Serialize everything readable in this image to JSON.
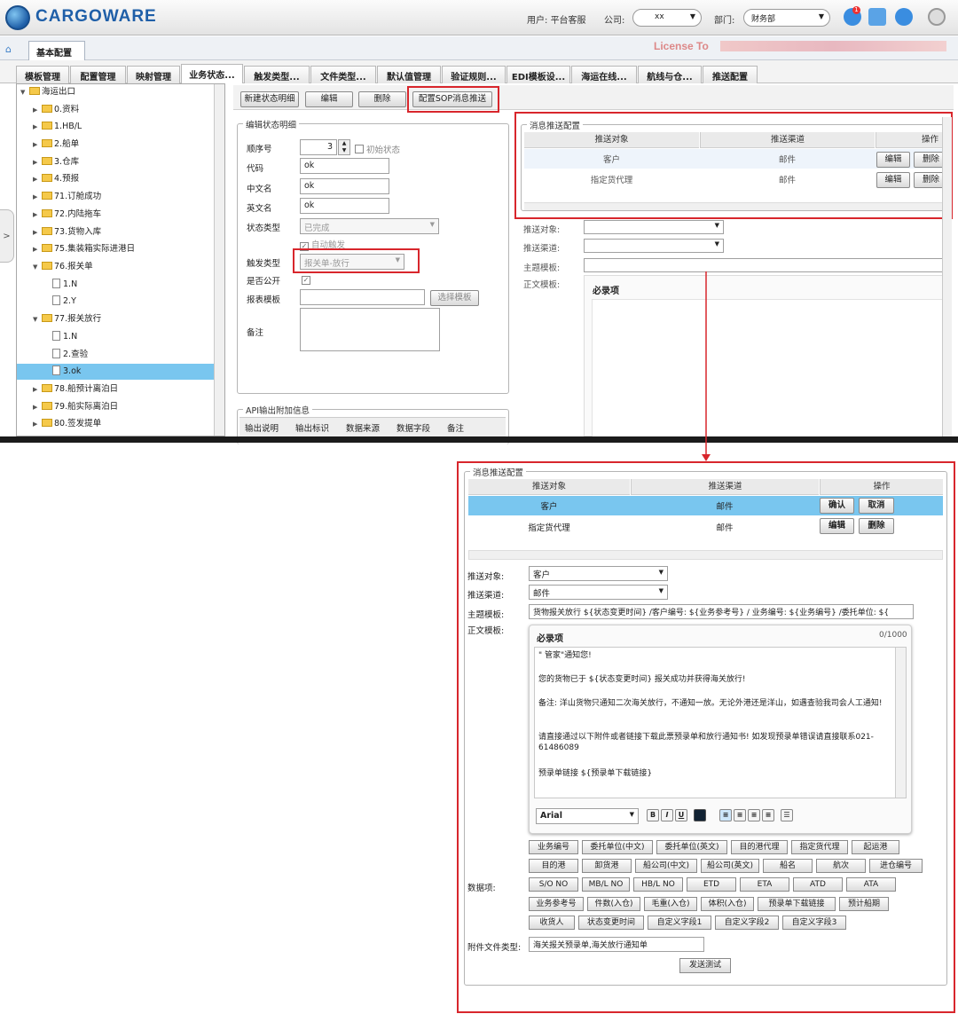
{
  "app": {
    "logo": "CARGOWARE"
  },
  "topbar": {
    "user_label": "用户:",
    "user_value": "平台客服",
    "company_label": "公司:",
    "company_value": "xx",
    "dept_label": "部门:",
    "dept_value": "财务部",
    "notif_count": "1"
  },
  "tabs_main": {
    "home_tab": "基本配置",
    "close": "×",
    "license": "License To"
  },
  "tabs_sub": [
    "模板管理",
    "配置管理",
    "映射管理",
    "业务状态...",
    "触发类型...",
    "文件类型...",
    "默认值管理",
    "验证规则...",
    "EDI模板设...",
    "海运在线...",
    "航线与仓...",
    "推送配置"
  ],
  "tree": {
    "root": "海运出口",
    "nodes": [
      "0.资料",
      "1.HB/L",
      "2.船单",
      "3.仓库",
      "4.预报",
      "71.订舱成功",
      "72.内陆拖车",
      "73.货物入库",
      "75.集装箱实际进港日",
      "76.报关单",
      "77.报关放行",
      "78.船预计离泊日",
      "79.船实际离泊日",
      "80.签发提单"
    ],
    "leaves_76": [
      "1.N",
      "2.Y"
    ],
    "leaves_77": [
      "1.N",
      "2.查验",
      "3.ok"
    ]
  },
  "toolbar": {
    "new": "新建状态明细",
    "edit": "编辑",
    "delete": "删除",
    "config_sop": "配置SOP消息推送"
  },
  "detail": {
    "legend": "编辑状态明细",
    "order_label": "顺序号",
    "order_value": "3",
    "init_status": "初始状态",
    "code_label": "代码",
    "code_value": "ok",
    "cn_label": "中文名",
    "cn_value": "ok",
    "en_label": "英文名",
    "en_value": "ok",
    "type_label": "状态类型",
    "type_value": "已完成",
    "auto_trigger": "自动触发",
    "trigger_label": "触发类型",
    "trigger_value": "报关单-放行",
    "public_label": "是否公开",
    "report_label": "报表模板",
    "report_btn": "选择模板",
    "remark_label": "备注"
  },
  "api": {
    "legend": "API输出附加信息",
    "cols": [
      "输出说明",
      "输出标识",
      "数据来源",
      "数据字段",
      "备注"
    ]
  },
  "push_top": {
    "legend": "消息推送配置",
    "cols": [
      "推送对象",
      "推送渠道",
      "操作"
    ],
    "rows": [
      {
        "target": "客户",
        "channel": "邮件",
        "edit": "编辑",
        "del": "删除"
      },
      {
        "target": "指定货代理",
        "channel": "邮件",
        "edit": "编辑",
        "del": "删除"
      }
    ],
    "target_label": "推送对象:",
    "channel_label": "推送渠道:",
    "subject_label": "主题模板:",
    "body_label": "正文模板:",
    "required": "必录项"
  },
  "push_bottom": {
    "legend": "消息推送配置",
    "cols": [
      "推送对象",
      "推送渠道",
      "操作"
    ],
    "rows": [
      {
        "target": "客户",
        "channel": "邮件",
        "btn1": "确认",
        "btn2": "取消"
      },
      {
        "target": "指定货代理",
        "channel": "邮件",
        "btn1": "编辑",
        "btn2": "删除"
      }
    ],
    "target_label": "推送对象:",
    "target_value": "客户",
    "channel_label": "推送渠道:",
    "channel_value": "邮件",
    "subject_label": "主题模板:",
    "subject_value": "货物报关放行 ${状态变更时间} /客户编号: ${业务参考号} /      业务编号: ${业务编号} /委托单位: ${",
    "body_label": "正文模板:",
    "required": "必录项",
    "counter": "0/1000",
    "body_lines": [
      "\"     管家\"通知您!",
      "您的货物已于 ${状态变更时间} 报关成功并获得海关放行!",
      "备注: 洋山货物只通知二次海关放行，不通知一放。无论外港还是洋山，如遇查验我司会人工通知!",
      "请直接通过以下附件或者链接下载此票预录单和放行通知书! 如发现预录单错误请直接联系021-61486089",
      "预录单链接 ${预录单下载链接}"
    ],
    "font": "Arial",
    "data_label": "数据项:",
    "data_rows": [
      [
        "业务编号",
        "委托单位(中文)",
        "委托单位(英文)",
        "目的港代理",
        "指定货代理",
        "起运港"
      ],
      [
        "目的港",
        "卸货港",
        "船公司(中文)",
        "船公司(英文)",
        "船名",
        "航次",
        "进仓编号"
      ],
      [
        "S/O NO",
        "MB/L NO",
        "HB/L NO",
        "ETD",
        "ETA",
        "ATD",
        "ATA"
      ],
      [
        "业务参考号",
        "件数(入仓)",
        "毛重(入仓)",
        "体积(入仓)",
        "预录单下载链接",
        "预计船期"
      ],
      [
        "收货人",
        "状态变更时间",
        "自定义字段1",
        "自定义字段2",
        "自定义字段3"
      ]
    ],
    "attach_label": "附件文件类型:",
    "attach_value": "海关报关预录单,海关放行通知单",
    "send_test": "发送测试"
  },
  "colors": {
    "accent": "#1f5fa8",
    "highlight": "#79c6ef",
    "red": "#d8262c"
  }
}
